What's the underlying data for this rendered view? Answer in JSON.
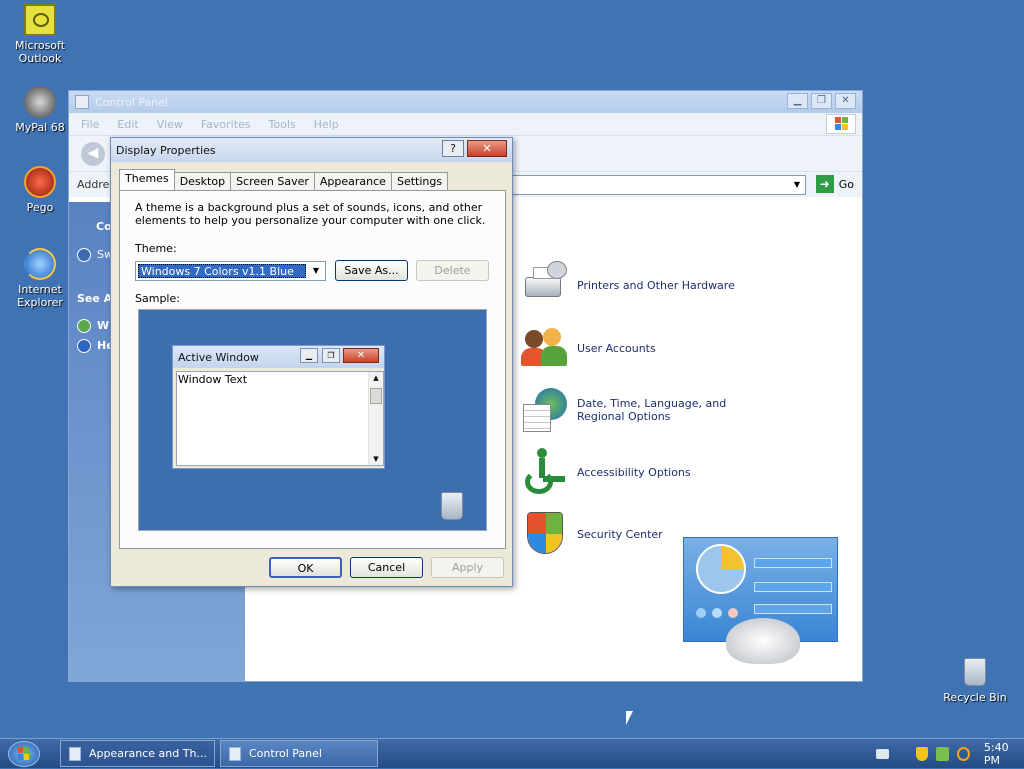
{
  "desktop": {
    "icons": [
      {
        "label": "Microsoft Outlook",
        "icon": "outlook-icon"
      },
      {
        "label": "MyPal 68",
        "icon": "mypal-icon"
      },
      {
        "label": "Pego",
        "icon": "pego-icon"
      },
      {
        "label": "Internet Explorer",
        "icon": "ie-icon"
      },
      {
        "label": "Recycle Bin",
        "icon": "recycle-bin-icon"
      }
    ]
  },
  "control_panel": {
    "title": "Control Panel",
    "menu": [
      "File",
      "Edit",
      "View",
      "Favorites",
      "Tools",
      "Help"
    ],
    "address_label": "Addres",
    "go_label": "Go",
    "sidebar": {
      "title": "Co",
      "switch": "Sw",
      "see_also": "See Al",
      "link1": "W",
      "link2": "He"
    },
    "categories": [
      {
        "label": "Printers and Other Hardware",
        "icon": "printer-icon"
      },
      {
        "label": "User Accounts",
        "icon": "users-icon"
      },
      {
        "label": "Date, Time, Language, and Regional Options",
        "icon": "globe-calendar-icon"
      },
      {
        "label": "Accessibility Options",
        "icon": "accessibility-icon"
      },
      {
        "label": "Security Center",
        "icon": "shield-icon"
      }
    ]
  },
  "display_properties": {
    "title": "Display Properties",
    "help_button": "?",
    "tabs": [
      "Themes",
      "Desktop",
      "Screen Saver",
      "Appearance",
      "Settings"
    ],
    "active_tab": "Themes",
    "description": "A theme is a background plus a set of sounds, icons, and other elements to help you personalize your computer with one click.",
    "theme_label": "Theme:",
    "theme_value": "Windows 7 Colors v1.1 Blue",
    "save_as": "Save As...",
    "delete": "Delete",
    "sample_label": "Sample:",
    "sample": {
      "window_title": "Active Window",
      "window_text": "Window Text"
    },
    "ok": "OK",
    "cancel": "Cancel",
    "apply": "Apply"
  },
  "taskbar": {
    "tasks": [
      "Appearance and Th...",
      "Control Panel"
    ],
    "clock": "5:40 PM"
  },
  "colors": {
    "desktop": "#3f73b4",
    "selection": "#316ac5",
    "taskbar": "#2d538f"
  }
}
